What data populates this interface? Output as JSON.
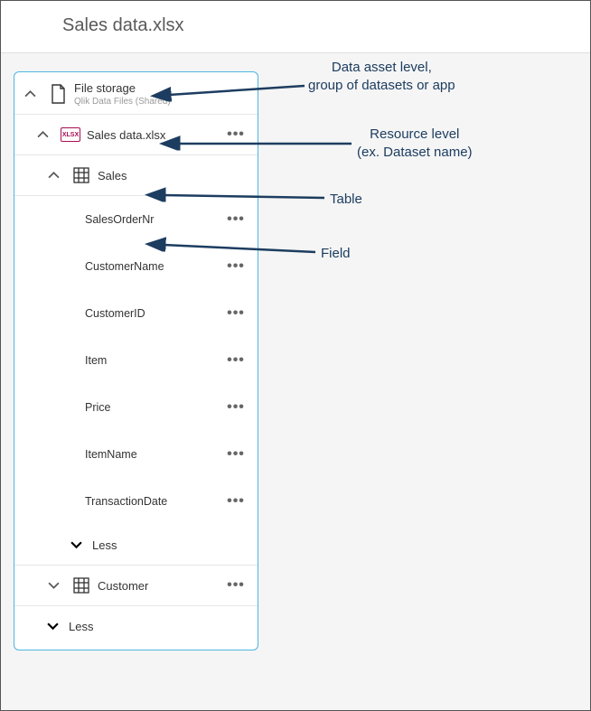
{
  "header": {
    "title": "Sales data.xlsx"
  },
  "asset": {
    "title": "File storage",
    "subtitle": "Qlik Data Files (Shared)"
  },
  "resource": {
    "title": "Sales data.xlsx"
  },
  "tables": {
    "sales": {
      "title": "Sales"
    },
    "customer": {
      "title": "Customer"
    }
  },
  "fields": [
    "SalesOrderNr",
    "CustomerName",
    "CustomerID",
    "Item",
    "Price",
    "ItemName",
    "TransactionDate"
  ],
  "less_label": "Less",
  "more_glyph": "•••",
  "annotations": {
    "asset": "Data asset level,\ngroup of datasets or app",
    "resource": "Resource level\n(ex. Dataset name)",
    "table": "Table",
    "field": "Field"
  }
}
